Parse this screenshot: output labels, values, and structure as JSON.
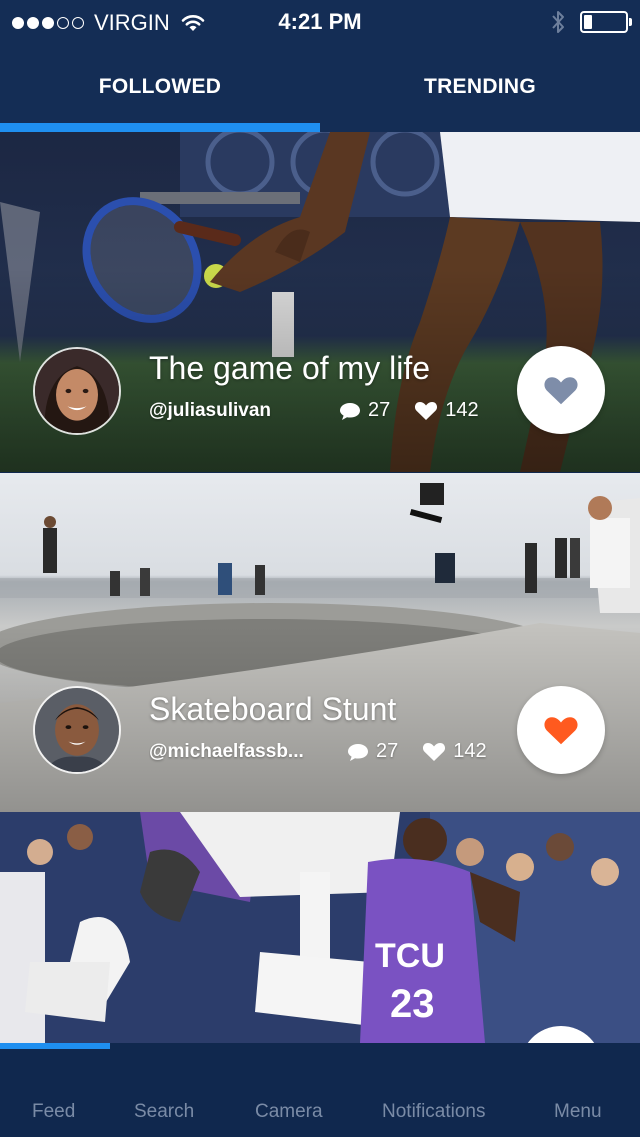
{
  "status_bar": {
    "carrier": "VIRGIN",
    "time": "4:21 PM",
    "signal_bars": 3,
    "signal_total": 5,
    "battery_level": 0.2
  },
  "tabs": [
    {
      "label": "FOLLOWED",
      "active": true
    },
    {
      "label": "TRENDING",
      "active": false
    }
  ],
  "posts": [
    {
      "title": "The game of my life",
      "handle": "@juliasulivan",
      "comments": "27",
      "likes": "142",
      "liked": false,
      "scene": "tennis"
    },
    {
      "title": "Skateboard Stunt",
      "handle": "@michaelfassb...",
      "comments": "27",
      "likes": "142",
      "liked": true,
      "scene": "skatepark"
    },
    {
      "title": "",
      "handle": "",
      "comments": "",
      "likes": "",
      "scene": "basketball",
      "jersey_text": "TCU",
      "jersey_number": "23"
    }
  ],
  "bottom_nav": [
    {
      "label": "Feed"
    },
    {
      "label": "Search"
    },
    {
      "label": "Camera"
    },
    {
      "label": "Notifications"
    },
    {
      "label": "Menu"
    }
  ],
  "colors": {
    "header_bg": "#142d55",
    "accent": "#1f8ff0",
    "heart_liked": "#ff5a1f",
    "heart_default": "#7e8da9",
    "nav_text": "#7a8ba6"
  }
}
